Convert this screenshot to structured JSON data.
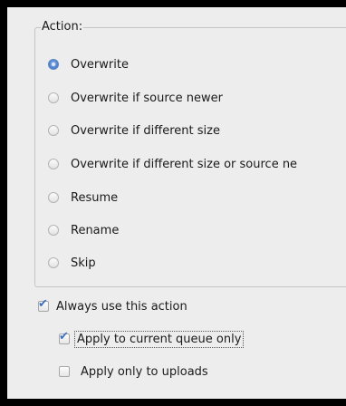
{
  "action_group": {
    "title": "Action:",
    "options": [
      {
        "label": "Overwrite",
        "checked": true
      },
      {
        "label": "Overwrite if source newer",
        "checked": false
      },
      {
        "label": "Overwrite if different size",
        "checked": false
      },
      {
        "label": "Overwrite if different size or source ne",
        "checked": false
      },
      {
        "label": "Resume",
        "checked": false
      },
      {
        "label": "Rename",
        "checked": false
      },
      {
        "label": "Skip",
        "checked": false
      }
    ]
  },
  "always_use": {
    "label": "Always use this action",
    "checked": true
  },
  "apply_queue": {
    "label": "Apply to current queue only",
    "checked": true
  },
  "apply_uploads": {
    "label": "Apply only to uploads",
    "checked": false
  }
}
